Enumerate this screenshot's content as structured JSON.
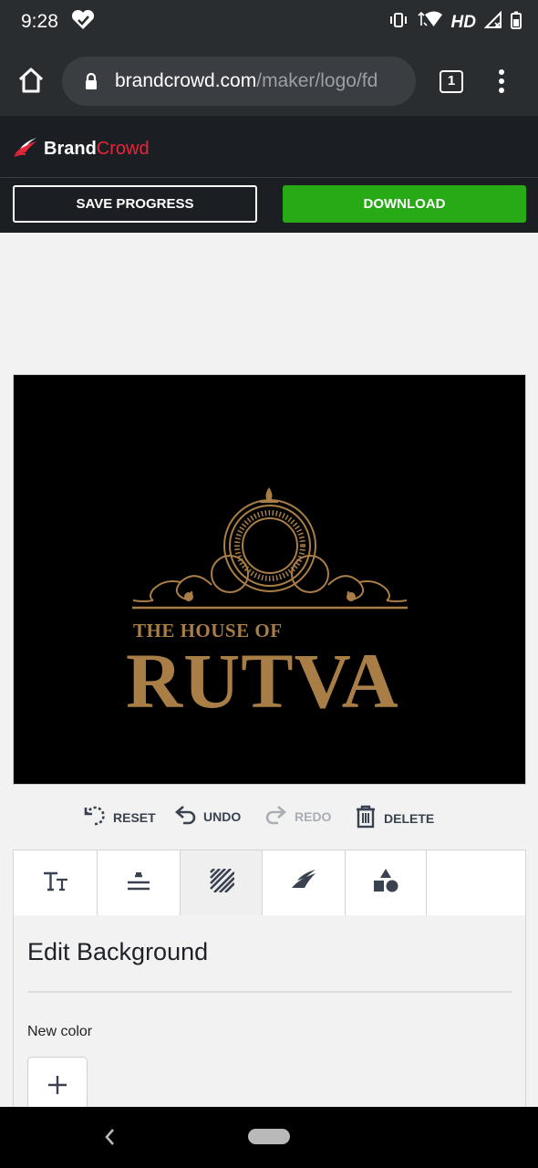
{
  "status_bar": {
    "time": "9:28",
    "network": "HD"
  },
  "browser": {
    "url_host": "brandcrowd.com",
    "url_path": "/maker/logo/fd",
    "tab_count": "1"
  },
  "app": {
    "brand_part1": "Brand",
    "brand_part2": "Crowd"
  },
  "actions": {
    "save_label": "SAVE PROGRESS",
    "download_label": "DOWNLOAD"
  },
  "logo_design": {
    "line1": "THE HOUSE OF",
    "line2": "RUTVA",
    "color": "#a87d46",
    "background": "#000000"
  },
  "tools": {
    "reset": "RESET",
    "undo": "UNDO",
    "redo": "REDO",
    "delete": "DELETE"
  },
  "editor": {
    "tabs": [
      "text-icon",
      "align-icon",
      "background-icon",
      "logo-icon",
      "shapes-icon"
    ],
    "active_tab": "background",
    "title": "Edit Background",
    "new_color_label": "New color"
  },
  "colors": {
    "accent_green": "#27aa16",
    "brand_red": "#e8263a",
    "header_bg": "#1b1e22"
  }
}
